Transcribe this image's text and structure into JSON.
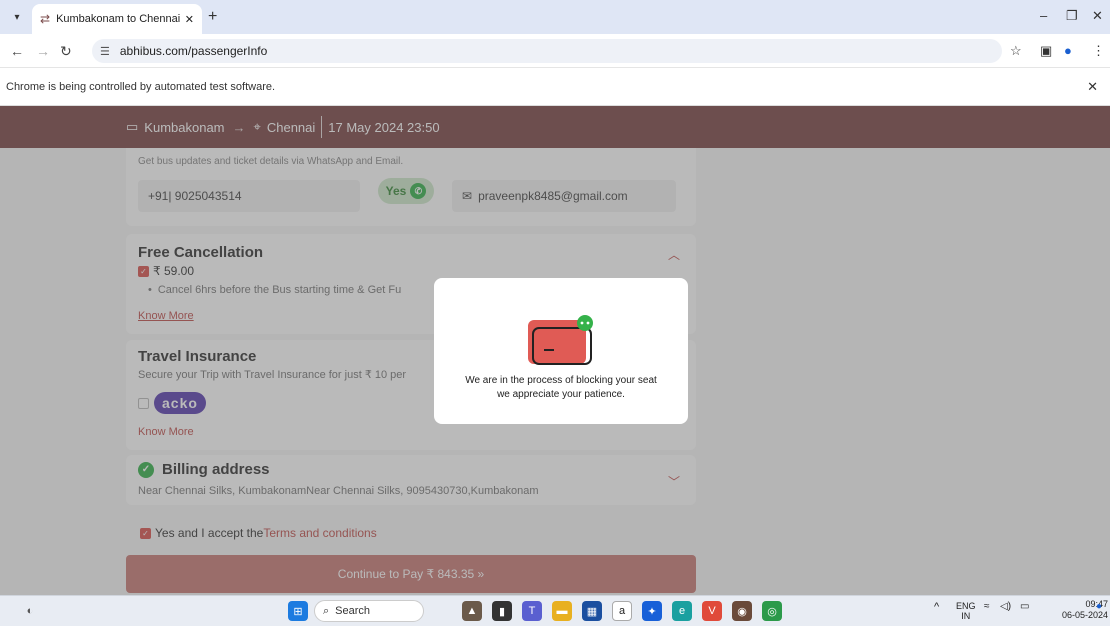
{
  "browser": {
    "tab_title": "Kumbakonam to Chennai Bus T",
    "new_tab_label": "+",
    "url": "abhibus.com/passengerInfo",
    "automation_notice": "Chrome is being controlled by automated test software."
  },
  "header": {
    "from": "Kumbakonam",
    "arrow": "→",
    "to": "Chennai",
    "datetime": "17 May 2024 23:50"
  },
  "contact": {
    "subtitle": "Get bus updates and ticket details via WhatsApp and Email.",
    "phone": "+91| 9025043514",
    "whatsapp_label": "Yes",
    "email": "praveenpk8485@gmail.com"
  },
  "free_cancellation": {
    "title": "Free Cancellation",
    "price": "₹ 59.00",
    "bullet": "Cancel 6hrs before the Bus starting time & Get Fu",
    "know_more": "Know More"
  },
  "travel_insurance": {
    "title": "Travel Insurance",
    "subtitle": "Secure your Trip with Travel Insurance for just ₹ 10 per",
    "brand": "acko",
    "know_more": "Know More"
  },
  "billing": {
    "title": "Billing address",
    "address": "Near Chennai Silks, KumbakonamNear Chennai Silks, 9095430730,Kumbakonam"
  },
  "terms": {
    "prefix": "Yes and I accept the",
    "link": "Terms and conditions"
  },
  "pay_button": "Continue to Pay ₹ 843.35  »",
  "modal": {
    "line1": "We are in the process of blocking your seat",
    "line2": "we appreciate your patience."
  },
  "taskbar": {
    "search_label": "Search",
    "lang": "ENG",
    "region": "IN",
    "time": "09:47",
    "date": "06-05-2024"
  },
  "colors": {
    "brand": "#7a4545",
    "accent": "#c0504d"
  }
}
